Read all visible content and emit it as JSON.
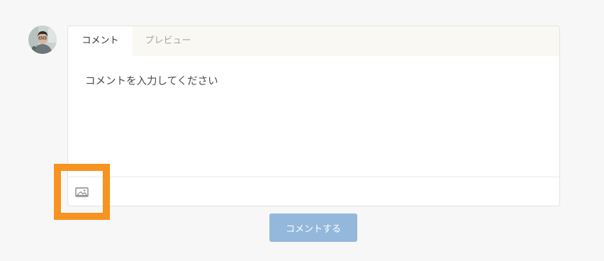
{
  "user": {
    "avatar_icon": "user-avatar-photo"
  },
  "editor": {
    "tabs": [
      {
        "label": "コメント",
        "active": true
      },
      {
        "label": "プレビュー",
        "active": false
      }
    ],
    "placeholder": "コメントを入力してください",
    "value": "",
    "toolbar": {
      "image_icon": "image-icon"
    }
  },
  "highlight": {
    "color": "#f7931e"
  },
  "submit": {
    "label": "コメントする",
    "color": "#94b8db"
  }
}
